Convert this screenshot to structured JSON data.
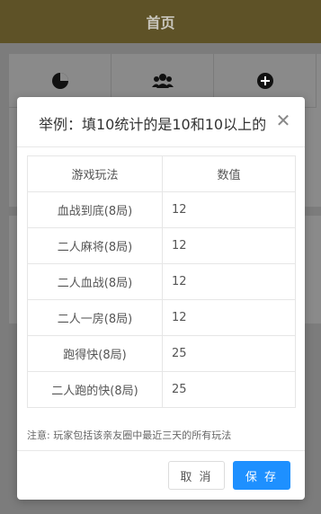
{
  "background": {
    "header_title": "首页",
    "header_color": "#5e5227",
    "grid_icons": [
      "pie-chart-icon",
      "group-icon",
      "plus-circle-icon"
    ]
  },
  "modal": {
    "title": "举例：填10统计的是10和10以上的",
    "close_icon": "close-icon",
    "table": {
      "headers": [
        "游戏玩法",
        "数值"
      ],
      "rows": [
        {
          "name": "血战到底(8局)",
          "value": "12"
        },
        {
          "name": "二人麻将(8局)",
          "value": "12"
        },
        {
          "name": "二人血战(8局)",
          "value": "12"
        },
        {
          "name": "二人一房(8局)",
          "value": "12"
        },
        {
          "name": "跑得快(8局)",
          "value": "25"
        },
        {
          "name": "二人跑的快(8局)",
          "value": "25"
        }
      ]
    },
    "note": "注意: 玩家包括该亲友圈中最近三天的所有玩法",
    "cancel_label": "取 消",
    "save_label": "保 存",
    "accent_color": "#1e90ff"
  }
}
